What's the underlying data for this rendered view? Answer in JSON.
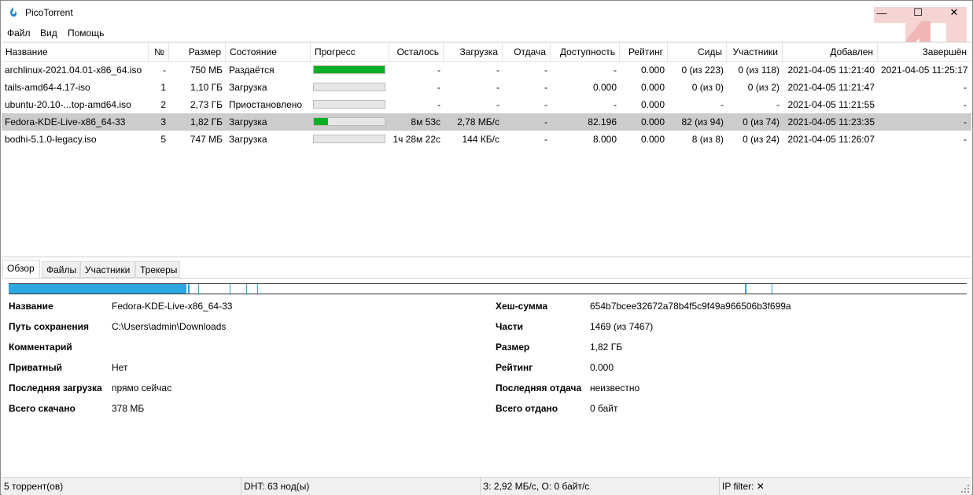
{
  "app": {
    "title": "PicoTorrent"
  },
  "window_controls": {
    "minimize": "—",
    "maximize": "☐",
    "close": "✕"
  },
  "menu": [
    "Файл",
    "Вид",
    "Помощь"
  ],
  "columns": [
    "Название",
    "№",
    "Размер",
    "Состояние",
    "Прогресс",
    "Осталось",
    "Загрузка",
    "Отдача",
    "Доступность",
    "Рейтинг",
    "Сиды",
    "Участники",
    "Добавлен",
    "Завершён"
  ],
  "torrents": [
    {
      "name": "archlinux-2021.04.01-x86_64.iso",
      "num": "-",
      "size": "750 МБ",
      "state": "Раздаётся",
      "progress": 1.0,
      "eta": "-",
      "dl": "-",
      "ul": "-",
      "avail": "-",
      "ratio": "0.000",
      "seeds": "0 (из 223)",
      "peers": "0 (из 118)",
      "added": "2021-04-05 11:21:40",
      "completed": "2021-04-05 11:25:17",
      "selected": false
    },
    {
      "name": "tails-amd64-4.17-iso",
      "num": "1",
      "size": "1,10 ГБ",
      "state": "Загрузка",
      "progress": 0.0,
      "eta": "-",
      "dl": "-",
      "ul": "-",
      "avail": "0.000",
      "ratio": "0.000",
      "seeds": "0 (из 0)",
      "peers": "0 (из 2)",
      "added": "2021-04-05 11:21:47",
      "completed": "-",
      "selected": false
    },
    {
      "name": "ubuntu-20.10-...top-amd64.iso",
      "num": "2",
      "size": "2,73 ГБ",
      "state": "Приостановлено",
      "progress": 0.0,
      "eta": "-",
      "dl": "-",
      "ul": "-",
      "avail": "-",
      "ratio": "0.000",
      "seeds": "-",
      "peers": "-",
      "added": "2021-04-05 11:21:55",
      "completed": "-",
      "selected": false
    },
    {
      "name": "Fedora-KDE-Live-x86_64-33",
      "num": "3",
      "size": "1,82 ГБ",
      "state": "Загрузка",
      "progress": 0.2,
      "eta": "8м 53с",
      "dl": "2,78 МБ/с",
      "ul": "-",
      "avail": "82.196",
      "ratio": "0.000",
      "seeds": "82 (из 94)",
      "peers": "0 (из 74)",
      "added": "2021-04-05 11:23:35",
      "completed": "-",
      "selected": true
    },
    {
      "name": "bodhi-5.1.0-legacy.iso",
      "num": "5",
      "size": "747 МБ",
      "state": "Загрузка",
      "progress": 0.0,
      "eta": "1ч 28м 22с",
      "dl": "144 КБ/с",
      "ul": "-",
      "avail": "8.000",
      "ratio": "0.000",
      "seeds": "8 (из 8)",
      "peers": "0 (из 24)",
      "added": "2021-04-05 11:26:07",
      "completed": "-",
      "selected": false
    }
  ],
  "tabs": [
    "Обзор",
    "Файлы",
    "Участники",
    "Трекеры"
  ],
  "details": {
    "left": [
      {
        "label": "Название",
        "value": "Fedora-KDE-Live-x86_64-33"
      },
      {
        "label": "Путь сохранения",
        "value": "C:\\Users\\admin\\Downloads"
      },
      {
        "label": "Комментарий",
        "value": ""
      },
      {
        "label": "Приватный",
        "value": "Нет"
      },
      {
        "label": "Последняя загрузка",
        "value": "прямо сейчас"
      },
      {
        "label": "Всего скачано",
        "value": "378 МБ"
      }
    ],
    "right": [
      {
        "label": "Хеш-сумма",
        "value": "654b7bcee32672a78b4f5c9f49a966506b3f699a"
      },
      {
        "label": "Части",
        "value": "1469 (из 7467)"
      },
      {
        "label": "Размер",
        "value": "1,82 ГБ"
      },
      {
        "label": "Рейтинг",
        "value": "0.000"
      },
      {
        "label": "Последняя отдача",
        "value": "неизвестно"
      },
      {
        "label": "Всего отдано",
        "value": "0 байт"
      }
    ]
  },
  "status": {
    "torrents": "5 торрент(ов)",
    "dht": "DHT: 63 нод(ы)",
    "speed": "З: 2,92 МБ/с, О: 0 байт/с",
    "ipfilter": "IP filter: ✕"
  },
  "colors": {
    "progress_green": "#06b025",
    "piece_blue": "#2ca7e0",
    "selected_row": "#cccccc",
    "logo_red": "#f2c7c7"
  }
}
